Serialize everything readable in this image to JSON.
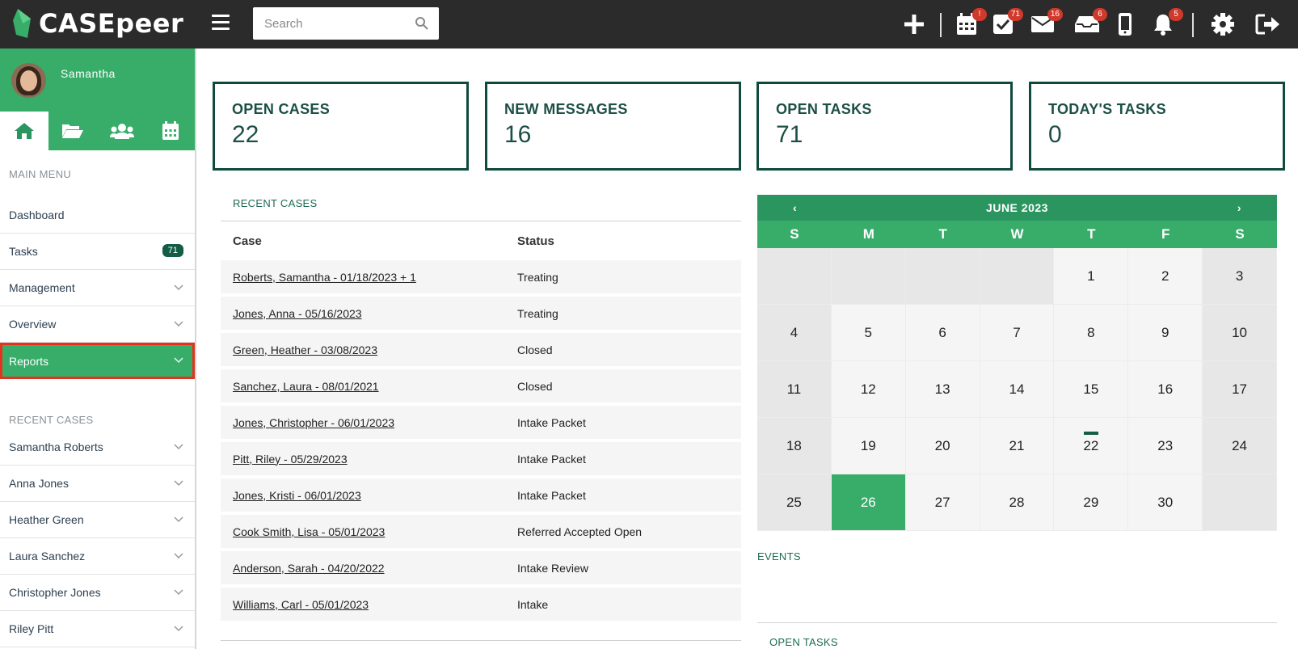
{
  "app": {
    "name": "CASEpeer"
  },
  "search": {
    "placeholder": "Search"
  },
  "topbar": {
    "badges": {
      "calendar": "!",
      "tasks": "71",
      "messages": "16",
      "inbox": "6",
      "notifications": "5"
    }
  },
  "user": {
    "name": "Samantha"
  },
  "sidebar": {
    "main_menu_heading": "MAIN MENU",
    "items": [
      {
        "label": "Dashboard"
      },
      {
        "label": "Tasks",
        "count": "71"
      },
      {
        "label": "Management"
      },
      {
        "label": "Overview"
      },
      {
        "label": "Reports"
      }
    ],
    "recent_heading": "RECENT CASES",
    "recent": [
      "Samantha Roberts",
      "Anna Jones",
      "Heather Green",
      "Laura Sanchez",
      "Christopher Jones",
      "Riley Pitt"
    ]
  },
  "stats": [
    {
      "label": "OPEN CASES",
      "value": "22"
    },
    {
      "label": "NEW MESSAGES",
      "value": "16"
    },
    {
      "label": "OPEN TASKS",
      "value": "71"
    },
    {
      "label": "TODAY'S TASKS",
      "value": "0"
    }
  ],
  "recent_cases": {
    "title": "RECENT CASES",
    "columns": [
      "Case",
      "Status"
    ],
    "rows": [
      {
        "case": "Roberts, Samantha - 01/18/2023 + 1",
        "status": "Treating"
      },
      {
        "case": "Jones, Anna - 05/16/2023",
        "status": "Treating"
      },
      {
        "case": "Green, Heather - 03/08/2023",
        "status": "Closed"
      },
      {
        "case": "Sanchez, Laura - 08/01/2021",
        "status": "Closed"
      },
      {
        "case": "Jones, Christopher - 06/01/2023",
        "status": "Intake Packet"
      },
      {
        "case": "Pitt, Riley - 05/29/2023",
        "status": "Intake Packet"
      },
      {
        "case": "Jones, Kristi - 06/01/2023",
        "status": "Intake Packet"
      },
      {
        "case": "Cook Smith, Lisa - 05/01/2023",
        "status": "Referred Accepted Open"
      },
      {
        "case": "Anderson, Sarah - 04/20/2022",
        "status": "Intake Review"
      },
      {
        "case": "Williams, Carl - 05/01/2023",
        "status": "Intake"
      }
    ]
  },
  "calendar": {
    "month": "JUNE 2023",
    "prev": "‹",
    "next": "›",
    "dow": [
      "S",
      "M",
      "T",
      "W",
      "T",
      "F",
      "S"
    ],
    "days": [
      "1",
      "2",
      "3",
      "4",
      "5",
      "6",
      "7",
      "8",
      "9",
      "10",
      "11",
      "12",
      "13",
      "14",
      "15",
      "16",
      "17",
      "18",
      "19",
      "20",
      "21",
      "22",
      "23",
      "24",
      "25",
      "26",
      "27",
      "28",
      "29",
      "30"
    ],
    "today": "26",
    "event_day": "22"
  },
  "events": {
    "title": "EVENTS"
  },
  "open_tasks": {
    "title": "OPEN TASKS"
  }
}
